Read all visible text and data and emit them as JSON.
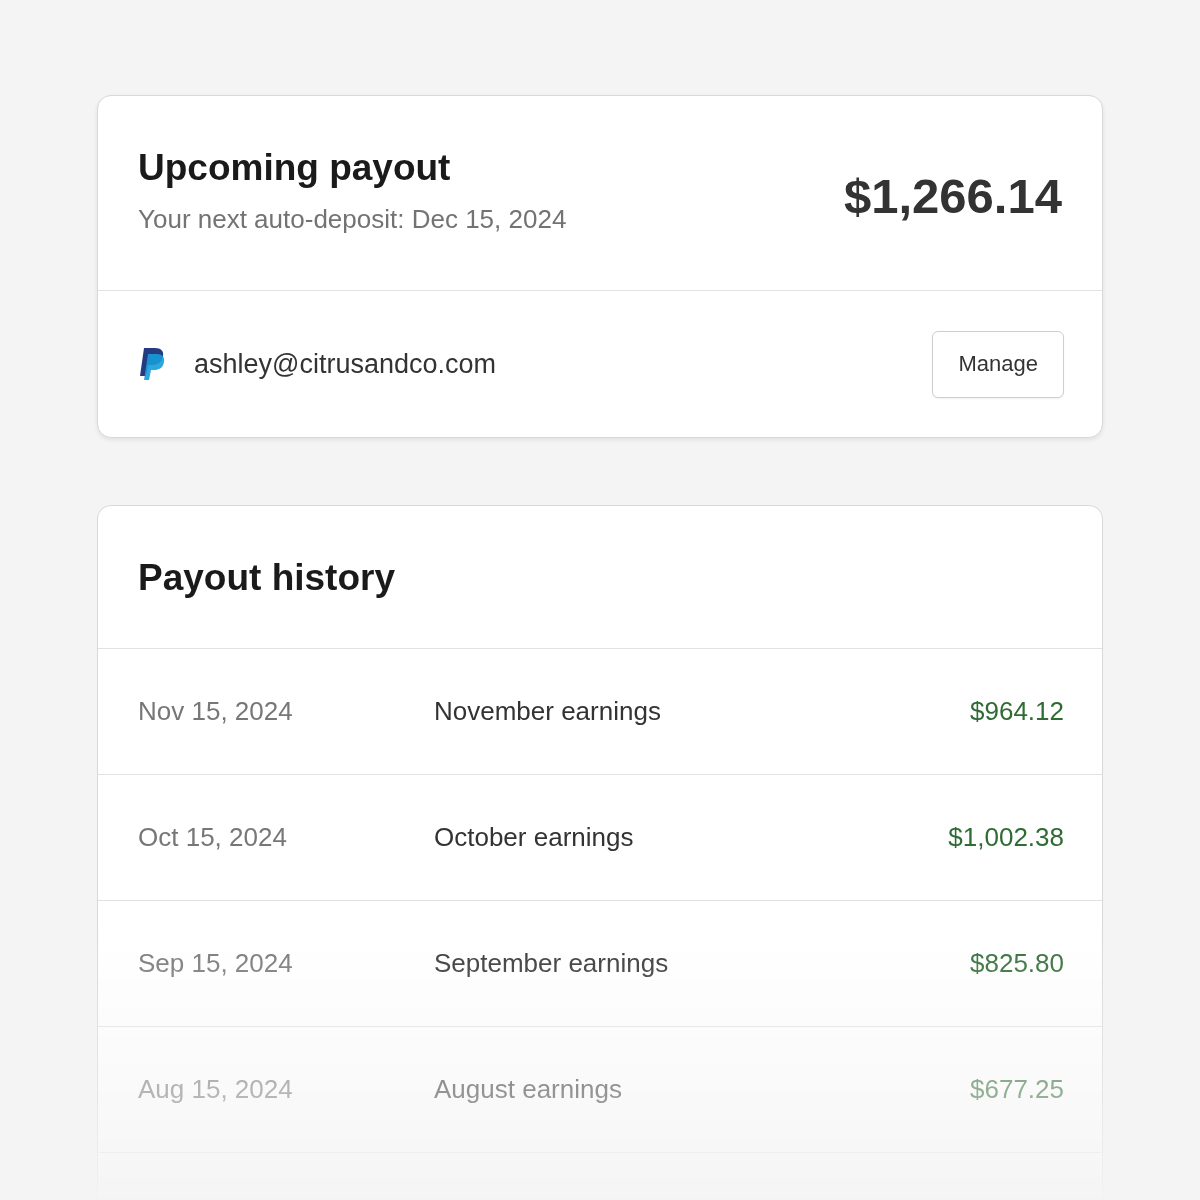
{
  "upcoming_payout": {
    "title": "Upcoming payout",
    "subtitle": "Your next auto-deposit: Dec 15, 2024",
    "amount": "$1,266.14",
    "account_email": "ashley@citrusandco.com",
    "manage_button": "Manage"
  },
  "payout_history": {
    "title": "Payout history",
    "rows": [
      {
        "date": "Nov 15, 2024",
        "description": "November earnings",
        "amount": "$964.12"
      },
      {
        "date": "Oct 15, 2024",
        "description": "October earnings",
        "amount": "$1,002.38"
      },
      {
        "date": "Sep 15, 2024",
        "description": "September earnings",
        "amount": "$825.80"
      },
      {
        "date": "Aug 15, 2024",
        "description": "August earnings",
        "amount": "$677.25"
      }
    ]
  }
}
